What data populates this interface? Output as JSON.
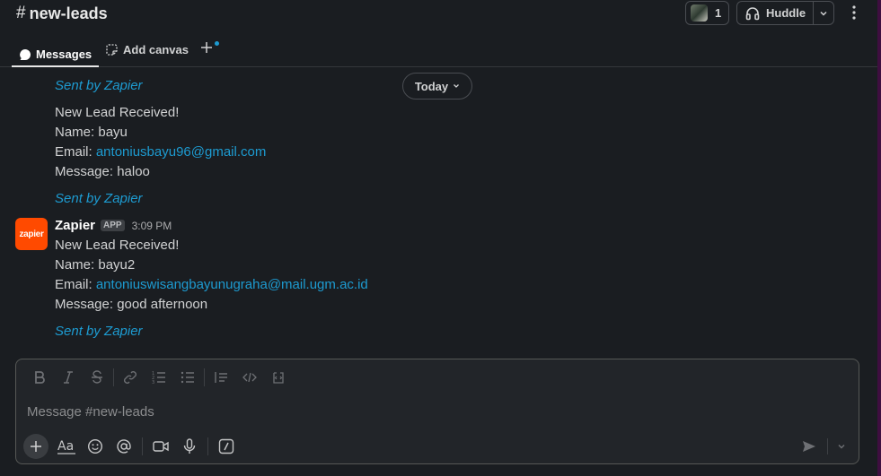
{
  "header": {
    "channel_name": "new-leads",
    "hash_symbol": "#",
    "member_count": "1",
    "huddle_label": "Huddle"
  },
  "tabs": [
    {
      "label": "Messages"
    },
    {
      "label": "Add canvas"
    }
  ],
  "date_divider": "Today",
  "messages": {
    "first": {
      "sent_by_top": "Sent by Zapier",
      "lines": {
        "title": "New Lead Received!",
        "name": "Name: bayu",
        "email_prefix": "Email: ",
        "email": "antoniusbayu96@gmail.com",
        "message": "Message: haloo"
      },
      "sent_by": "Sent by Zapier"
    },
    "second": {
      "sender": "Zapier",
      "avatar_text": "zapier",
      "badge": "APP",
      "time": "3:09 PM",
      "lines": {
        "title": "New Lead Received!",
        "name": "Name: bayu2",
        "email_prefix": "Email: ",
        "email": "antoniuswisangbayunugraha@mail.ugm.ac.id",
        "message": "Message: good afternoon"
      },
      "sent_by": "Sent by Zapier"
    }
  },
  "composer": {
    "placeholder": "Message #new-leads"
  },
  "colors": {
    "background": "#1a1d21",
    "link": "#1d9bd1",
    "zapier_orange": "#ff4a00",
    "sidebar_accent": "#3f0e40"
  }
}
